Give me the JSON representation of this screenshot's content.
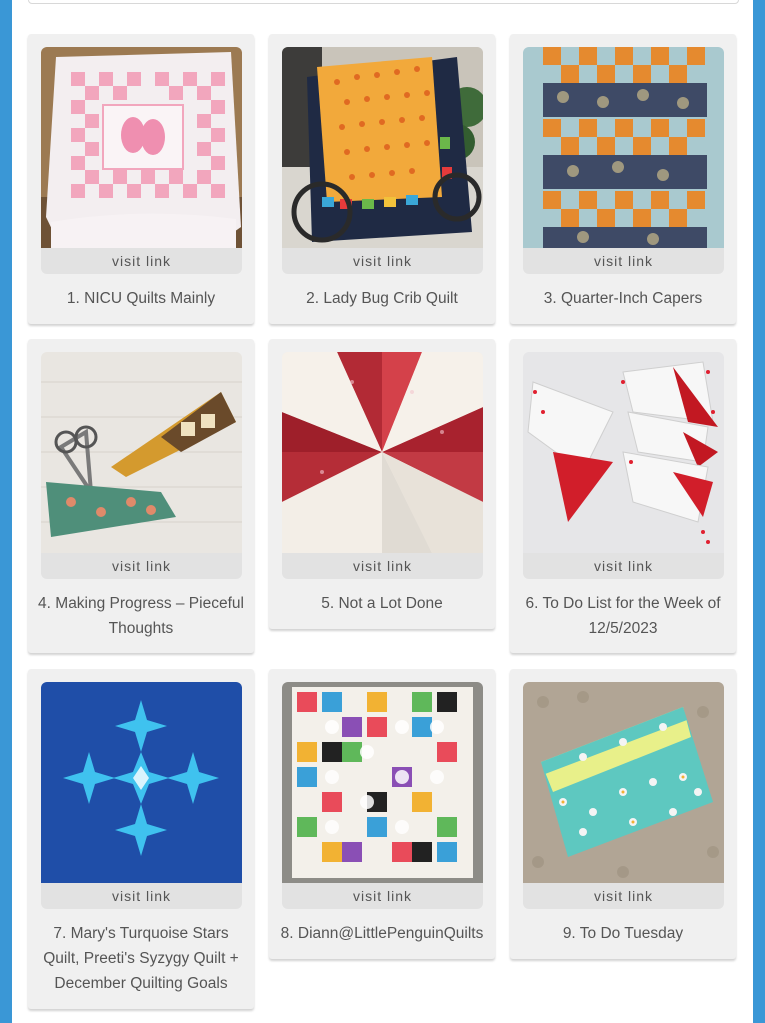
{
  "link_label": "visit link",
  "entries": [
    {
      "caption": "1. NICU Quilts Mainly"
    },
    {
      "caption": "2. Lady Bug Crib Quilt"
    },
    {
      "caption": "3. Quarter-Inch Capers"
    },
    {
      "caption": "4. Making Progress – Pieceful Thoughts"
    },
    {
      "caption": "5. Not a Lot Done"
    },
    {
      "caption": "6. To Do List for the Week of 12/5/2023"
    },
    {
      "caption": "7. Mary's Turquoise Stars Quilt, Preeti's Syzygy Quilt + December Quilting Goals"
    },
    {
      "caption": "8. Diann@LittlePenguinQuilts"
    },
    {
      "caption": "9. To Do Tuesday"
    }
  ],
  "colors": {
    "frame": "#3a97d6",
    "card": "#f0f0f0",
    "link_bar": "#e2e2e2",
    "text": "#555555"
  }
}
